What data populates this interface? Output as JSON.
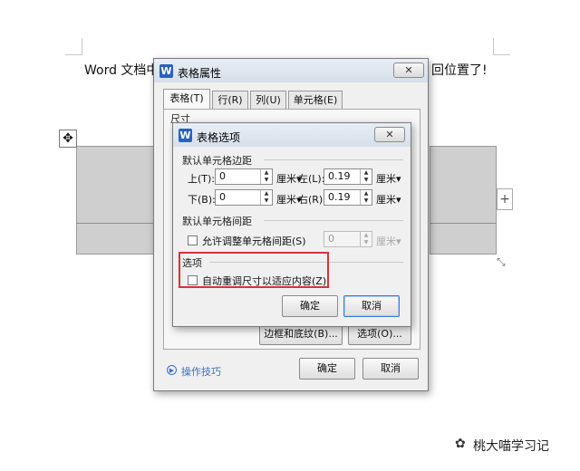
{
  "document": {
    "text_left": "Word 文档中",
    "text_right": "回位置了!",
    "move_icon": "move-icon",
    "add_column_icon": "plus-icon",
    "resize_icon": "resize-icon"
  },
  "outer_dialog": {
    "title": "表格属性",
    "close": "✕",
    "tabs": [
      "表格(T)",
      "行(R)",
      "列(U)",
      "单元格(E)"
    ],
    "size_label": "尺寸",
    "borders_button": "边框和底纹(B)...",
    "options_button": "选项(O)...",
    "tips_link": "操作技巧",
    "ok": "确定",
    "cancel": "取消"
  },
  "inner_dialog": {
    "title": "表格选项",
    "close": "✕",
    "margins_label": "默认单元格边距",
    "top_label": "上(T):",
    "top_value": "0",
    "top_unit": "厘米▾",
    "left_label": "左(L):",
    "left_value": "0.19",
    "left_unit": "厘米▾",
    "bottom_label": "下(B):",
    "bottom_value": "0",
    "bottom_unit": "厘米▾",
    "right_label": "右(R):",
    "right_value": "0.19",
    "right_unit": "厘米▾",
    "spacing_label": "默认单元格间距",
    "allow_spacing_label": "允许调整单元格间距(S)",
    "spacing_value": "0",
    "spacing_unit": "厘米▾",
    "options_label": "选项",
    "autofit_label": "自动重调尺寸以适应内容(Z)",
    "ok": "确定",
    "cancel": "取消"
  },
  "watermark": {
    "text": "桃大喵学习记",
    "icon": "wechat-icon"
  },
  "colors": {
    "highlight": "#d9323a",
    "accent": "#2a62b8",
    "link": "#3b6fc4"
  }
}
